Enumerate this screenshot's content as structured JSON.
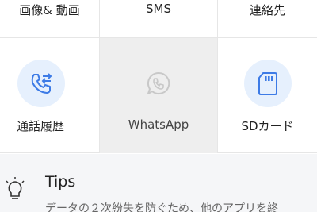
{
  "top_row": {
    "images_videos": "画像& 動画",
    "sms": "SMS",
    "contacts": "連絡先"
  },
  "tiles": [
    {
      "label": "通話履歴",
      "icon": "call-log-icon",
      "selected": false
    },
    {
      "label": "WhatsApp",
      "icon": "whatsapp-icon",
      "selected": true
    },
    {
      "label": "SDカード",
      "icon": "sd-card-icon",
      "selected": false
    }
  ],
  "tips": {
    "icon": "lightbulb-icon",
    "title": "Tips",
    "text": "データの２次紛失を防ぐため、他のアプリを終"
  },
  "colors": {
    "accent": "#3d7be6",
    "icon_bg": "#e6f0fd",
    "selected_bg": "#eeeeee",
    "tips_bg": "#f5f6f8"
  }
}
